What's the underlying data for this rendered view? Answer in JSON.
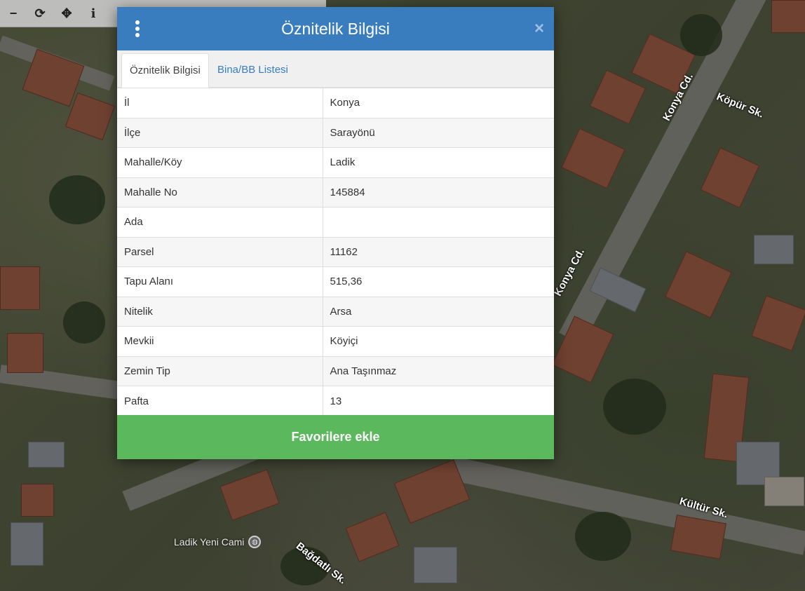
{
  "toolbar": {
    "tools": [
      {
        "name": "zoom-out-icon",
        "glyph": "−"
      },
      {
        "name": "refresh-icon",
        "glyph": "⟳"
      },
      {
        "name": "pan-icon",
        "glyph": "✥"
      },
      {
        "name": "info-icon",
        "glyph": "i"
      }
    ]
  },
  "map": {
    "streets": [
      "Konya Cd.",
      "Köpür Sk.",
      "Konya Cd.",
      "Kültür Sk.",
      "Bağdatlı Sk."
    ],
    "poi": "Ladik Yeni Cami"
  },
  "dialog": {
    "title": "Öznitelik Bilgisi",
    "close": "×",
    "tabs": [
      "Öznitelik Bilgisi",
      "Bina/BB Listesi"
    ],
    "rows": [
      {
        "key": "İl",
        "value": "Konya"
      },
      {
        "key": "İlçe",
        "value": "Sarayönü"
      },
      {
        "key": "Mahalle/Köy",
        "value": "Ladik"
      },
      {
        "key": "Mahalle No",
        "value": "145884"
      },
      {
        "key": "Ada",
        "value": ""
      },
      {
        "key": "Parsel",
        "value": "11162"
      },
      {
        "key": "Tapu Alanı",
        "value": "515,36"
      },
      {
        "key": "Nitelik",
        "value": "Arsa"
      },
      {
        "key": "Mevkii",
        "value": "Köyiçi"
      },
      {
        "key": "Zemin Tip",
        "value": "Ana Taşınmaz"
      },
      {
        "key": "Pafta",
        "value": "13"
      }
    ],
    "favorite_button": "Favorilere ekle"
  },
  "colors": {
    "header": "#3a7dbf",
    "button": "#5cb85c",
    "link": "#3a7dbf"
  }
}
